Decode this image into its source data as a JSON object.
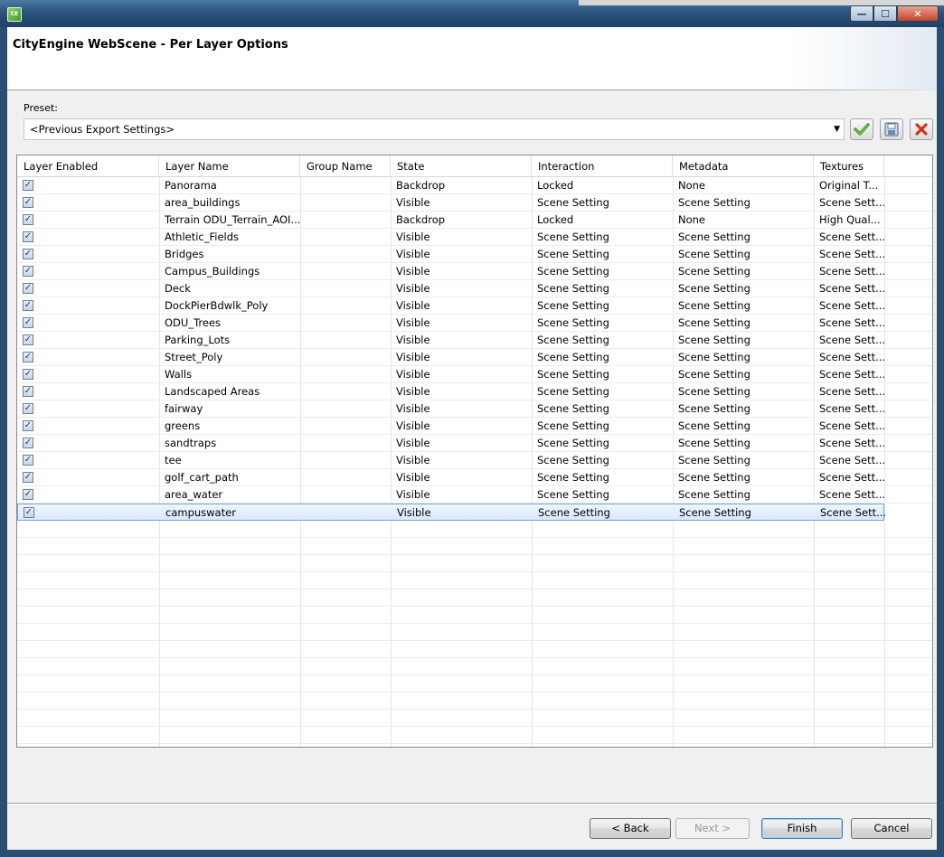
{
  "window": {
    "title_icon": "CE",
    "controls": {
      "minimize": "—",
      "maximize": "☐",
      "close": "✕"
    }
  },
  "header": {
    "title": "CityEngine WebScene - Per Layer Options"
  },
  "preset": {
    "label": "Preset:",
    "value": "<Previous Export Settings>",
    "arrow": "▼"
  },
  "table": {
    "columns": [
      "Layer Enabled",
      "Layer Name",
      "Group Name",
      "State",
      "Interaction",
      "Metadata",
      "Textures"
    ],
    "rows": [
      {
        "enabled": true,
        "name": "Panorama",
        "group": "",
        "state": "Backdrop",
        "interaction": "Locked",
        "metadata": "None",
        "textures": "Original T..."
      },
      {
        "enabled": true,
        "name": "area_buildings",
        "group": "",
        "state": "Visible",
        "interaction": "Scene Setting",
        "metadata": "Scene Setting",
        "textures": "Scene Sett..."
      },
      {
        "enabled": true,
        "name": "Terrain ODU_Terrain_AOI...",
        "group": "",
        "state": "Backdrop",
        "interaction": "Locked",
        "metadata": "None",
        "textures": "High Qual..."
      },
      {
        "enabled": true,
        "name": "Athletic_Fields",
        "group": "",
        "state": "Visible",
        "interaction": "Scene Setting",
        "metadata": "Scene Setting",
        "textures": "Scene Sett..."
      },
      {
        "enabled": true,
        "name": "Bridges",
        "group": "",
        "state": "Visible",
        "interaction": "Scene Setting",
        "metadata": "Scene Setting",
        "textures": "Scene Sett..."
      },
      {
        "enabled": true,
        "name": "Campus_Buildings",
        "group": "",
        "state": "Visible",
        "interaction": "Scene Setting",
        "metadata": "Scene Setting",
        "textures": "Scene Sett..."
      },
      {
        "enabled": true,
        "name": "Deck",
        "group": "",
        "state": "Visible",
        "interaction": "Scene Setting",
        "metadata": "Scene Setting",
        "textures": "Scene Sett..."
      },
      {
        "enabled": true,
        "name": "DockPierBdwlk_Poly",
        "group": "",
        "state": "Visible",
        "interaction": "Scene Setting",
        "metadata": "Scene Setting",
        "textures": "Scene Sett..."
      },
      {
        "enabled": true,
        "name": "ODU_Trees",
        "group": "",
        "state": "Visible",
        "interaction": "Scene Setting",
        "metadata": "Scene Setting",
        "textures": "Scene Sett..."
      },
      {
        "enabled": true,
        "name": "Parking_Lots",
        "group": "",
        "state": "Visible",
        "interaction": "Scene Setting",
        "metadata": "Scene Setting",
        "textures": "Scene Sett..."
      },
      {
        "enabled": true,
        "name": "Street_Poly",
        "group": "",
        "state": "Visible",
        "interaction": "Scene Setting",
        "metadata": "Scene Setting",
        "textures": "Scene Sett..."
      },
      {
        "enabled": true,
        "name": "Walls",
        "group": "",
        "state": "Visible",
        "interaction": "Scene Setting",
        "metadata": "Scene Setting",
        "textures": "Scene Sett..."
      },
      {
        "enabled": true,
        "name": "Landscaped Areas",
        "group": "",
        "state": "Visible",
        "interaction": "Scene Setting",
        "metadata": "Scene Setting",
        "textures": "Scene Sett..."
      },
      {
        "enabled": true,
        "name": "fairway",
        "group": "",
        "state": "Visible",
        "interaction": "Scene Setting",
        "metadata": "Scene Setting",
        "textures": "Scene Sett..."
      },
      {
        "enabled": true,
        "name": "greens",
        "group": "",
        "state": "Visible",
        "interaction": "Scene Setting",
        "metadata": "Scene Setting",
        "textures": "Scene Sett..."
      },
      {
        "enabled": true,
        "name": "sandtraps",
        "group": "",
        "state": "Visible",
        "interaction": "Scene Setting",
        "metadata": "Scene Setting",
        "textures": "Scene Sett..."
      },
      {
        "enabled": true,
        "name": "tee",
        "group": "",
        "state": "Visible",
        "interaction": "Scene Setting",
        "metadata": "Scene Setting",
        "textures": "Scene Sett..."
      },
      {
        "enabled": true,
        "name": "golf_cart_path",
        "group": "",
        "state": "Visible",
        "interaction": "Scene Setting",
        "metadata": "Scene Setting",
        "textures": "Scene Sett..."
      },
      {
        "enabled": true,
        "name": "area_water",
        "group": "",
        "state": "Visible",
        "interaction": "Scene Setting",
        "metadata": "Scene Setting",
        "textures": "Scene Sett..."
      },
      {
        "enabled": true,
        "name": "campuswater",
        "group": "",
        "state": "Visible",
        "interaction": "Scene Setting",
        "metadata": "Scene Setting",
        "textures": "Scene Sett...",
        "selected": true
      }
    ]
  },
  "footer": {
    "back": "< Back",
    "next": "Next >",
    "finish": "Finish",
    "cancel": "Cancel"
  },
  "icons": {
    "apply": "check-icon",
    "save": "save-icon",
    "delete": "delete-icon"
  },
  "colors": {
    "titlebar": "#2d5680",
    "selection": "#d8e9fb",
    "apply_green": "#3c9a2e",
    "delete_red": "#d0321f"
  }
}
